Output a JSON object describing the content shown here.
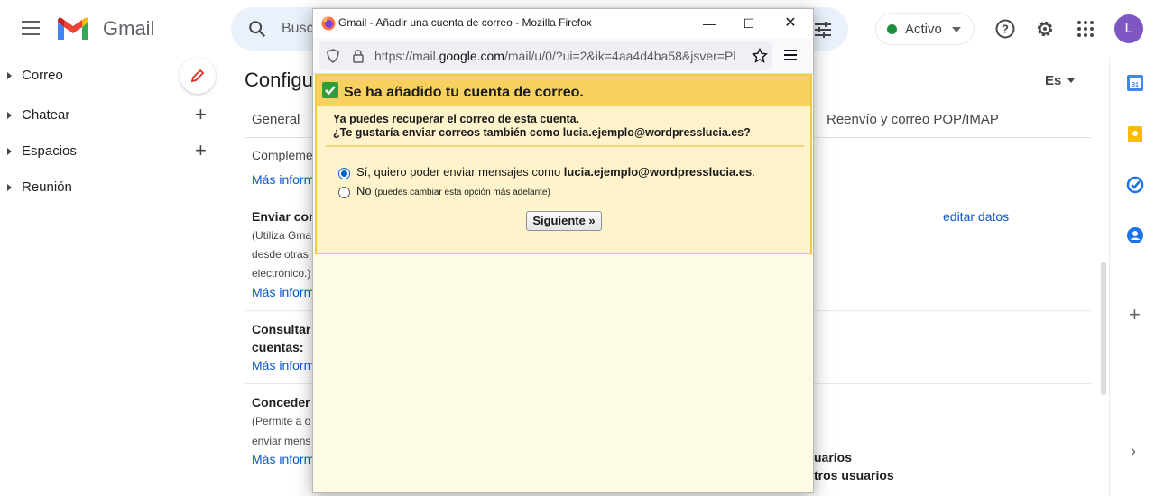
{
  "gmail": {
    "logo_text": "Gmail",
    "search_placeholder": "Busc",
    "status_label": "Activo",
    "avatar_letter": "L",
    "language": "Es"
  },
  "sidebar": {
    "items": [
      {
        "label": "Correo"
      },
      {
        "label": "Chatear"
      },
      {
        "label": "Espacios"
      },
      {
        "label": "Reunión"
      }
    ]
  },
  "settings": {
    "title": "Configu",
    "tab_general": "General",
    "tab_forwarding": "Reenvío y correo POP/IMAP",
    "complement": "Compleme",
    "more_info": "Más inform",
    "send_as_title": "Enviar com",
    "send_as_desc": [
      "(Utiliza Gma",
      "desde otras",
      "electrónico.)"
    ],
    "edit_data": "editar datos",
    "check_title": [
      "Consultar",
      "cuentas:"
    ],
    "grant_title": "Conceder a",
    "grant_desc": [
      "(Permite a o",
      "enviar mens"
    ],
    "right_text_1": "uarios",
    "right_text_2": "tros usuarios"
  },
  "popup": {
    "window_title": "Gmail - Añadir una cuenta de correo - Mozilla Firefox",
    "url_prefix": "https://mail.",
    "url_domain": "google.com",
    "url_rest": "/mail/u/0/?ui=2&ik=4aa4d4ba58&jsver=Pl",
    "success_message": "Se ha añadido tu cuenta de correo.",
    "line1": "Ya puedes recuperar el correo de esta cuenta.",
    "line2": "¿Te gustaría enviar correos también como lucia.ejemplo@wordpresslucia.es?",
    "option_yes_prefix": "Sí, quiero poder enviar mensajes como ",
    "option_yes_email": "lucia.ejemplo@wordpresslucia.es",
    "option_yes_suffix": ".",
    "option_no": "No",
    "option_no_note": "(puedes cambiar esta opción más adelante)",
    "next_button": "Siguiente »",
    "selected_option": "yes"
  },
  "colors": {
    "accent": "#0b57d0",
    "status_green": "#1e8e3e",
    "success_bar": "#f7d060",
    "avatar": "#7e57c2"
  }
}
